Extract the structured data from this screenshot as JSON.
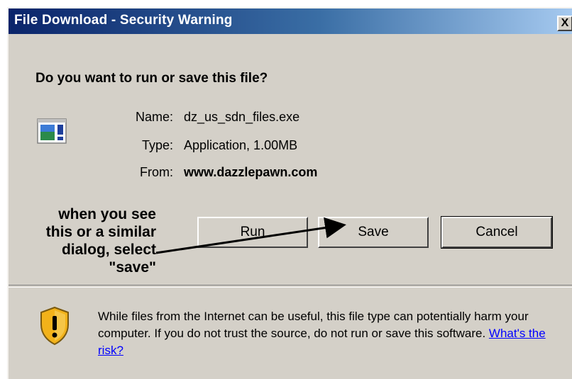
{
  "window": {
    "title": "File Download - Security Warning",
    "close_glyph": "X"
  },
  "dialog": {
    "question": "Do you want to run or save this file?",
    "icon": "application-window-icon",
    "file": {
      "name_label": "Name:",
      "name_value": "dz_us_sdn_files.exe",
      "type_label": "Type:",
      "type_value": "Application, 1.00MB",
      "from_label": "From:",
      "from_value": "www.dazzlepawn.com"
    },
    "buttons": {
      "run": "Run",
      "save": "Save",
      "cancel": "Cancel"
    },
    "warning": {
      "icon": "shield-warning-icon",
      "text": "While files from the Internet can be useful, this file type can potentially harm your computer. If you do not trust the source, do not run or save this software. ",
      "link": "What's the risk?"
    }
  },
  "annotation": {
    "text": "when you see\nthis or a similar\ndialog, select\n\"save\"",
    "arrow": "arrow-pointing-to-save"
  },
  "colors": {
    "titlebar_start": "#0a246a",
    "titlebar_end": "#a6caf0",
    "dialog_bg": "#d4d0c8",
    "link": "#0000ff",
    "shield_yellow": "#f2b21a"
  }
}
